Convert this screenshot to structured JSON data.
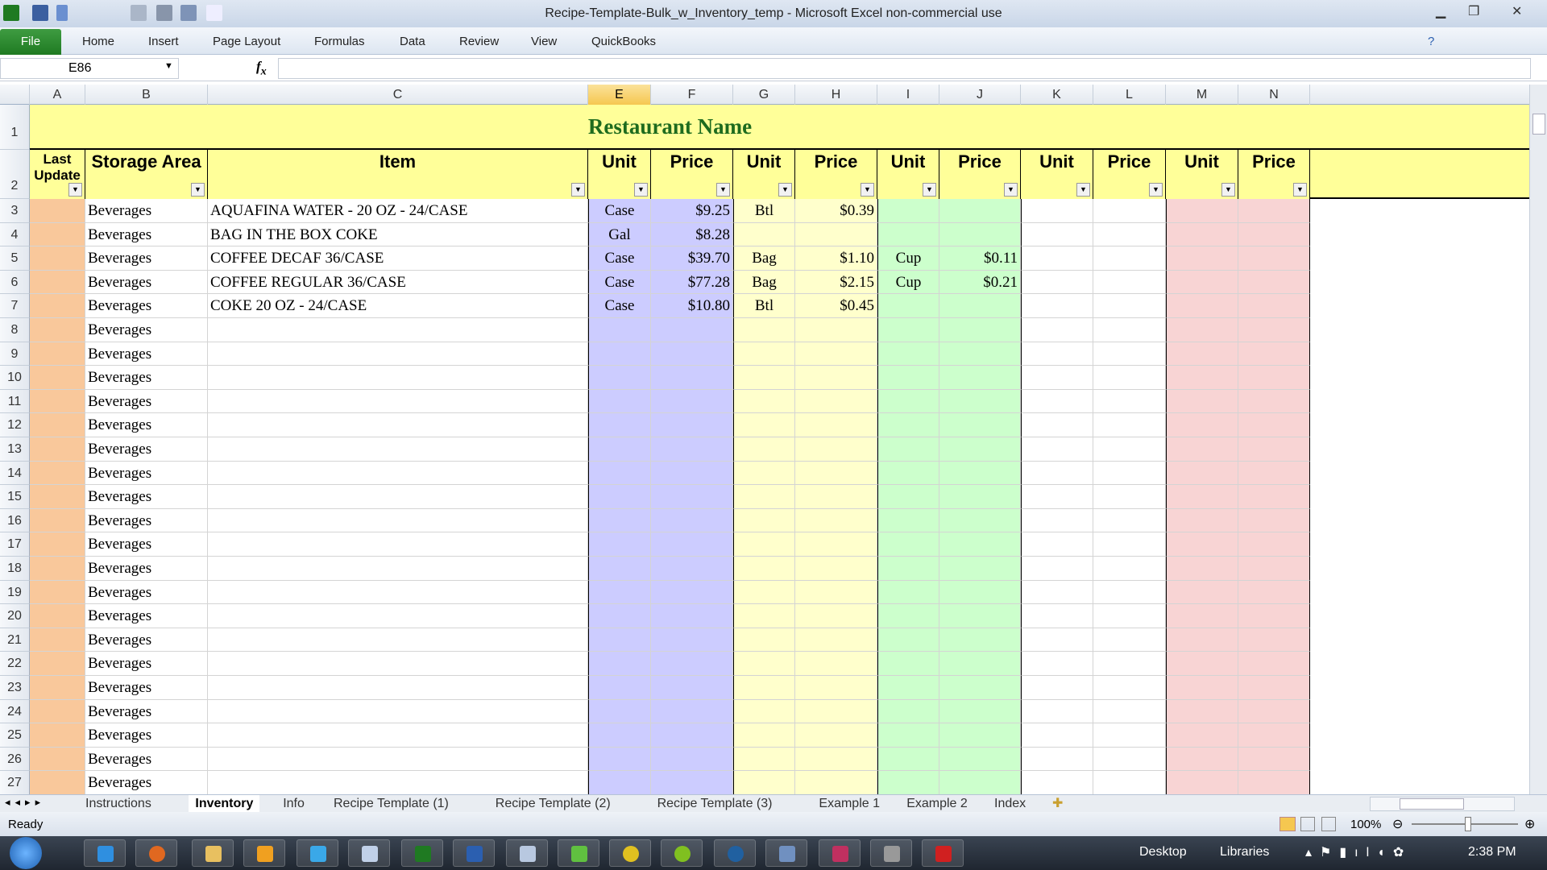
{
  "window": {
    "title": "Recipe-Template-Bulk_w_Inventory_temp  -  Microsoft Excel non-commercial use"
  },
  "ribbon": {
    "tabs": [
      "File",
      "Home",
      "Insert",
      "Page Layout",
      "Formulas",
      "Data",
      "Review",
      "View",
      "QuickBooks"
    ]
  },
  "formula_bar": {
    "name_box": "E86",
    "fx": "fx",
    "value": ""
  },
  "columns": [
    "A",
    "B",
    "C",
    "E",
    "F",
    "G",
    "H",
    "I",
    "J",
    "K",
    "L",
    "M",
    "N"
  ],
  "selected_column": "E",
  "sheet": {
    "title": "Restaurant Name",
    "headers": [
      "Last Update",
      "Storage Area",
      "Item",
      "Unit",
      "Price",
      "Unit",
      "Price",
      "Unit",
      "Price",
      "Unit",
      "Price",
      "Unit",
      "Price"
    ],
    "rows": [
      {
        "num": "3",
        "area": "Beverages",
        "item": "AQUAFINA WATER - 20 OZ - 24/CASE",
        "e": "Case",
        "f": "$9.25",
        "g": "Btl",
        "h": "$0.39",
        "i": "",
        "j": ""
      },
      {
        "num": "4",
        "area": "Beverages",
        "item": "BAG IN THE BOX COKE",
        "e": "Gal",
        "f": "$8.28",
        "g": "",
        "h": "",
        "i": "",
        "j": ""
      },
      {
        "num": "5",
        "area": "Beverages",
        "item": "COFFEE DECAF 36/CASE",
        "e": "Case",
        "f": "$39.70",
        "g": "Bag",
        "h": "$1.10",
        "i": "Cup",
        "j": "$0.11"
      },
      {
        "num": "6",
        "area": "Beverages",
        "item": "COFFEE REGULAR 36/CASE",
        "e": "Case",
        "f": "$77.28",
        "g": "Bag",
        "h": "$2.15",
        "i": "Cup",
        "j": "$0.21"
      },
      {
        "num": "7",
        "area": "Beverages",
        "item": "COKE 20 OZ - 24/CASE",
        "e": "Case",
        "f": "$10.80",
        "g": "Btl",
        "h": "$0.45",
        "i": "",
        "j": ""
      },
      {
        "num": "8",
        "area": "Beverages"
      },
      {
        "num": "9",
        "area": "Beverages"
      },
      {
        "num": "10",
        "area": "Beverages"
      },
      {
        "num": "11",
        "area": "Beverages"
      },
      {
        "num": "12",
        "area": "Beverages"
      },
      {
        "num": "13",
        "area": "Beverages"
      },
      {
        "num": "14",
        "area": "Beverages"
      },
      {
        "num": "15",
        "area": "Beverages"
      },
      {
        "num": "16",
        "area": "Beverages"
      },
      {
        "num": "17",
        "area": "Beverages"
      },
      {
        "num": "18",
        "area": "Beverages"
      },
      {
        "num": "19",
        "area": "Beverages"
      },
      {
        "num": "20",
        "area": "Beverages"
      },
      {
        "num": "21",
        "area": "Beverages"
      },
      {
        "num": "22",
        "area": "Beverages"
      },
      {
        "num": "23",
        "area": "Beverages"
      },
      {
        "num": "24",
        "area": "Beverages"
      },
      {
        "num": "25",
        "area": "Beverages"
      },
      {
        "num": "26",
        "area": "Beverages"
      },
      {
        "num": "27",
        "area": "Beverages"
      }
    ]
  },
  "colors": {
    "col_a": "#f9c89b",
    "col_ef": "#ccccff",
    "col_gh": "#ffffcc",
    "col_ij": "#ccffcc",
    "col_kl": "#ffffff",
    "col_mn": "#f8d4d4",
    "header": "#ffff99",
    "title": "#1e6b1e"
  },
  "sheet_tabs": [
    "Instructions",
    "Inventory",
    "Info",
    "Recipe Template (1)",
    "Recipe Template (2)",
    "Recipe Template (3)",
    "Example 1",
    "Example 2",
    "Index"
  ],
  "active_tab": "Inventory",
  "status": {
    "text": "Ready",
    "zoom": "100%"
  },
  "taskbar": {
    "desktop": "Desktop",
    "libraries": "Libraries",
    "time": "2:38 PM"
  }
}
